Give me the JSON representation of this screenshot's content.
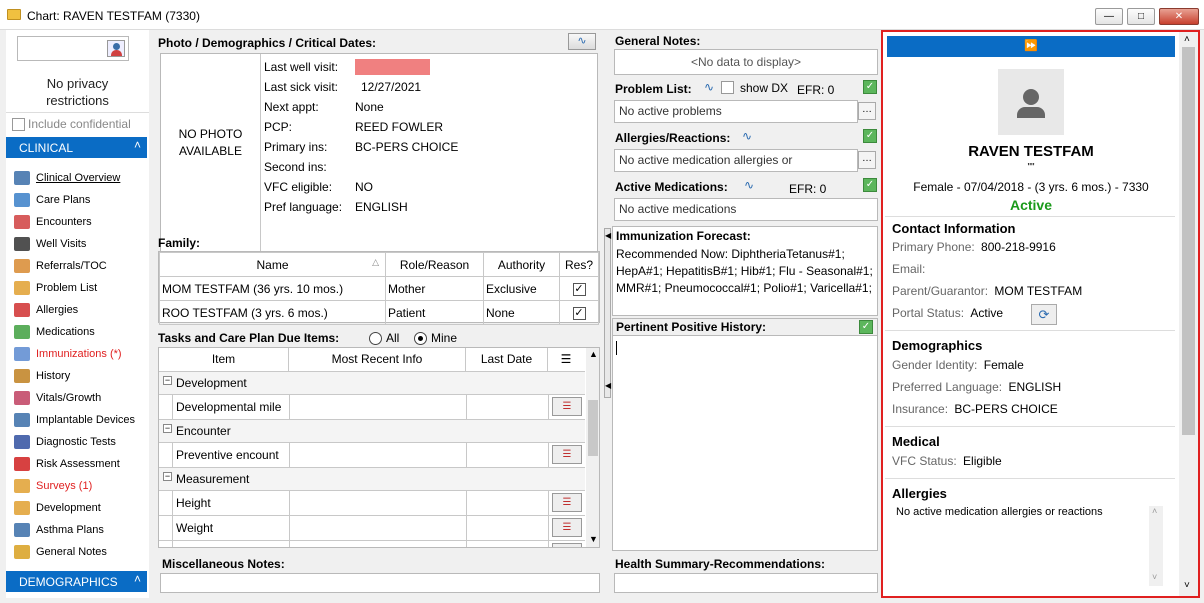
{
  "window": {
    "title": "Chart: RAVEN TESTFAM (7330)"
  },
  "privacy": {
    "text1": "No privacy",
    "text2": "restrictions",
    "include_confidential": "Include confidential"
  },
  "sections": {
    "clinical": "CLINICAL",
    "demographics": "DEMOGRAPHICS"
  },
  "nav": [
    {
      "label": "Clinical Overview",
      "color": "#000",
      "underline": true,
      "icon_color": "#3a6da8"
    },
    {
      "label": "Care Plans",
      "color": "#000",
      "icon_color": "#3a7fc8"
    },
    {
      "label": "Encounters",
      "color": "#000",
      "icon_color": "#d04040"
    },
    {
      "label": "Well Visits",
      "color": "#000",
      "icon_color": "#333"
    },
    {
      "label": "Referrals/TOC",
      "color": "#000",
      "icon_color": "#d88a30"
    },
    {
      "label": "Problem List",
      "color": "#000",
      "icon_color": "#e0a030"
    },
    {
      "label": "Allergies",
      "color": "#000",
      "icon_color": "#d03030"
    },
    {
      "label": "Medications",
      "color": "#000",
      "icon_color": "#40a040"
    },
    {
      "label": "Immunizations (*)",
      "color": "#e02020",
      "icon_color": "#5a8ad0"
    },
    {
      "label": "History",
      "color": "#000",
      "icon_color": "#c08020"
    },
    {
      "label": "Vitals/Growth",
      "color": "#000",
      "icon_color": "#c04060"
    },
    {
      "label": "Implantable Devices",
      "color": "#000",
      "icon_color": "#3a6da8"
    },
    {
      "label": "Diagnostic Tests",
      "color": "#000",
      "icon_color": "#3050a0"
    },
    {
      "label": "Risk Assessment",
      "color": "#000",
      "icon_color": "#d02020"
    },
    {
      "label": "Surveys (1)",
      "color": "#e02020",
      "icon_color": "#e0a030"
    },
    {
      "label": "Development",
      "color": "#000",
      "icon_color": "#e0a030"
    },
    {
      "label": "Asthma Plans",
      "color": "#000",
      "icon_color": "#3a6da8"
    },
    {
      "label": "General Notes",
      "color": "#000",
      "icon_color": "#d8a020"
    }
  ],
  "photo": {
    "heading": "Photo / Demographics / Critical Dates:",
    "no_photo_1": "NO PHOTO",
    "no_photo_2": "AVAILABLE"
  },
  "demo": [
    {
      "label": "Last well visit:",
      "value": "",
      "highlight": true
    },
    {
      "label": "Last sick visit:",
      "value": "12/27/2021"
    },
    {
      "label": "Next appt:",
      "value": "None"
    },
    {
      "label": "PCP:",
      "value": "REED FOWLER"
    },
    {
      "label": "Primary ins:",
      "value": "BC-PERS CHOICE"
    },
    {
      "label": "Second ins:",
      "value": ""
    },
    {
      "label": "VFC eligible:",
      "value": "NO"
    },
    {
      "label": "Pref language:",
      "value": "ENGLISH"
    }
  ],
  "family": {
    "heading": "Family:",
    "columns": [
      "Name",
      "Role/Reason",
      "Authority",
      "Res?"
    ],
    "rows": [
      {
        "name": "MOM  TESTFAM (36 yrs. 10 mos.)",
        "role": "Mother",
        "authority": "Exclusive",
        "res": true
      },
      {
        "name": "ROO  TESTFAM (3 yrs. 6 mos.)",
        "role": "Patient",
        "authority": "None",
        "res": true
      }
    ]
  },
  "tasks": {
    "heading": "Tasks and Care Plan Due Items:",
    "opt_all": "All",
    "opt_mine": "Mine",
    "columns": [
      "Item",
      "Most Recent Info",
      "Last Date"
    ],
    "groups": [
      {
        "name": "Development",
        "items": [
          "Developmental mile"
        ]
      },
      {
        "name": "Encounter",
        "items": [
          "Preventive encount"
        ]
      },
      {
        "name": "Measurement",
        "items": [
          "Height",
          "Weight",
          "Most recent BMI"
        ]
      }
    ]
  },
  "misc": {
    "heading": "Miscellaneous Notes:"
  },
  "general_notes": {
    "heading": "General Notes:",
    "empty": "<No data to display>"
  },
  "problem_list": {
    "heading": "Problem List:",
    "show_dx": "show DX",
    "efr": "EFR: 0",
    "value": "No active problems"
  },
  "allergies": {
    "heading": "Allergies/Reactions:",
    "value": "No active medication allergies or"
  },
  "medications": {
    "heading": "Active Medications:",
    "efr": "EFR: 0",
    "value": "No active medications"
  },
  "immunization": {
    "heading": "Immunization Forecast:",
    "text": "Recommended Now: DiphtheriaTetanus#1; HepA#1;  HepatitisB#1;  Hib#1;  Flu - Seasonal#1;  MMR#1;  Pneumococcal#1; Polio#1;  Varicella#1;"
  },
  "pph": {
    "heading": "Pertinent Positive History:"
  },
  "health_summary": {
    "heading": "Health Summary-Recommendations:"
  },
  "patient": {
    "name": "RAVEN  TESTFAM",
    "quote": "\"\"",
    "info": "Female - 07/04/2018 - (3 yrs. 6 mos.) - 7330",
    "status": "Active"
  },
  "contact": {
    "heading": "Contact Information",
    "rows": [
      {
        "label": "Primary Phone:",
        "value": "800-218-9916"
      },
      {
        "label": "Email:",
        "value": ""
      },
      {
        "label": "Parent/Guarantor:",
        "value": "MOM TESTFAM"
      },
      {
        "label": "Portal Status:",
        "value": "Active"
      }
    ]
  },
  "demographics": {
    "heading": "Demographics",
    "rows": [
      {
        "label": "Gender Identity:",
        "value": "Female"
      },
      {
        "label": "Preferred Language:",
        "value": "ENGLISH"
      },
      {
        "label": "Insurance:",
        "value": "BC-PERS CHOICE"
      }
    ]
  },
  "medical": {
    "heading": "Medical",
    "rows": [
      {
        "label": "VFC Status:",
        "value": "Eligible"
      }
    ]
  },
  "allergies_panel": {
    "heading": "Allergies",
    "text": "No active medication allergies or reactions"
  },
  "colors": {
    "accent": "#0a6cc5",
    "active": "#1a9a1a",
    "highlight": "#f08080",
    "alert": "#e02020"
  }
}
